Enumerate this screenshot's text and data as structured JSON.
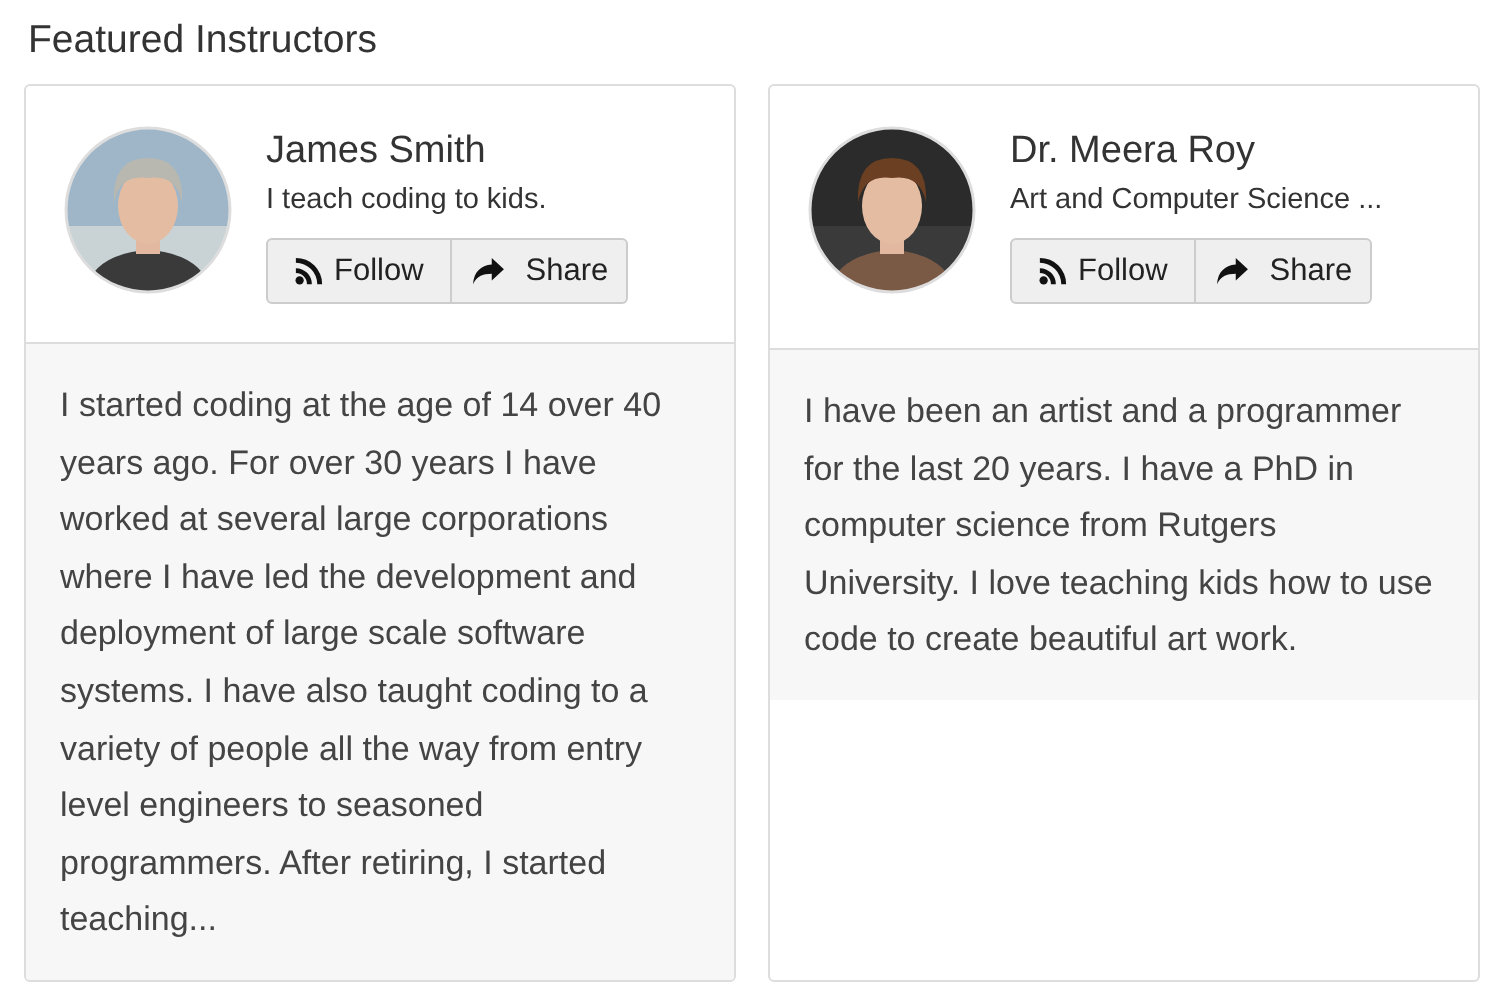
{
  "heading": "Featured Instructors",
  "instructors": [
    {
      "name": "James Smith",
      "tagline": "I teach coding to kids.",
      "follow": "Follow",
      "share": "Share",
      "bio": "I started coding at the age of 14 over 40 years ago. For over 30 years I have worked at several large corporations where I have led the development and deployment of large scale software systems. I have also taught coding to a variety of people all the way from entry level engineers to seasoned programmers. After retiring, I started teaching..."
    },
    {
      "name": "Dr. Meera Roy",
      "tagline": "Art and Computer Science ...",
      "follow": "Follow",
      "share": "Share",
      "bio": "I have been an artist and a programmer for the last 20 years. I have a PhD in computer science from Rutgers University. I love teaching kids how to use code to create beautiful art work."
    }
  ]
}
